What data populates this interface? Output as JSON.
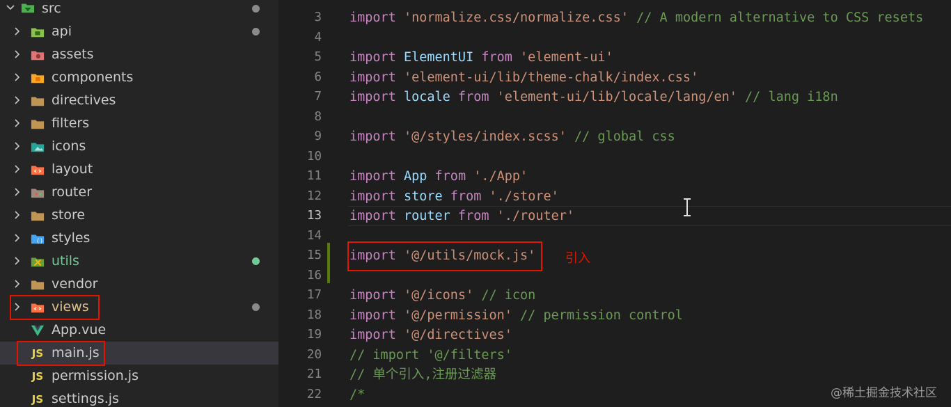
{
  "explorer": {
    "root": {
      "label": "src"
    },
    "items": [
      {
        "label": "api",
        "icon": "api-folder-icon",
        "dot": "#8a8a8a"
      },
      {
        "label": "assets",
        "icon": "assets-folder-icon"
      },
      {
        "label": "components",
        "icon": "components-folder-icon"
      },
      {
        "label": "directives",
        "icon": "folder-icon"
      },
      {
        "label": "filters",
        "icon": "folder-icon"
      },
      {
        "label": "icons",
        "icon": "images-folder-icon"
      },
      {
        "label": "layout",
        "icon": "layout-folder-icon"
      },
      {
        "label": "router",
        "icon": "router-folder-icon"
      },
      {
        "label": "store",
        "icon": "folder-icon"
      },
      {
        "label": "styles",
        "icon": "styles-folder-icon"
      },
      {
        "label": "utils",
        "icon": "utils-folder-icon",
        "dot": "#73c991"
      },
      {
        "label": "vendor",
        "icon": "folder-icon"
      },
      {
        "label": "views",
        "icon": "views-folder-icon",
        "dot": "#8a8a8a"
      },
      {
        "label": "App.vue",
        "icon": "vue-icon"
      },
      {
        "label": "main.js",
        "icon": "js-icon"
      },
      {
        "label": "permission.js",
        "icon": "js-icon"
      },
      {
        "label": "settings.js",
        "icon": "js-icon"
      }
    ],
    "js_badge": "JS"
  },
  "editor": {
    "lines": [
      {
        "n": "3",
        "tokens": [
          [
            "kw",
            "import "
          ],
          [
            "str",
            "'normalize.css/normalize.css'"
          ],
          [
            "pl",
            " "
          ],
          [
            "cmt",
            "// A modern alternative to CSS resets"
          ]
        ]
      },
      {
        "n": "4",
        "tokens": []
      },
      {
        "n": "5",
        "tokens": [
          [
            "kw",
            "import "
          ],
          [
            "id",
            "ElementUI"
          ],
          [
            "kw",
            " from "
          ],
          [
            "str",
            "'element-ui'"
          ]
        ]
      },
      {
        "n": "6",
        "tokens": [
          [
            "kw",
            "import "
          ],
          [
            "str",
            "'element-ui/lib/theme-chalk/index.css'"
          ]
        ]
      },
      {
        "n": "7",
        "tokens": [
          [
            "kw",
            "import "
          ],
          [
            "id",
            "locale"
          ],
          [
            "kw",
            " from "
          ],
          [
            "str",
            "'element-ui/lib/locale/lang/en'"
          ],
          [
            "pl",
            " "
          ],
          [
            "cmt",
            "// lang i18n"
          ]
        ]
      },
      {
        "n": "8",
        "tokens": []
      },
      {
        "n": "9",
        "tokens": [
          [
            "kw",
            "import "
          ],
          [
            "str",
            "'@/styles/index.scss'"
          ],
          [
            "pl",
            " "
          ],
          [
            "cmt",
            "// global css"
          ]
        ]
      },
      {
        "n": "10",
        "tokens": []
      },
      {
        "n": "11",
        "tokens": [
          [
            "kw",
            "import "
          ],
          [
            "id",
            "App"
          ],
          [
            "kw",
            " from "
          ],
          [
            "str",
            "'./App'"
          ]
        ]
      },
      {
        "n": "12",
        "tokens": [
          [
            "kw",
            "import "
          ],
          [
            "id",
            "store"
          ],
          [
            "kw",
            " from "
          ],
          [
            "str",
            "'./store'"
          ]
        ]
      },
      {
        "n": "13",
        "tokens": [
          [
            "kw",
            "import "
          ],
          [
            "id",
            "router"
          ],
          [
            "kw",
            " from "
          ],
          [
            "str",
            "'./router'"
          ]
        ]
      },
      {
        "n": "14",
        "tokens": []
      },
      {
        "n": "15",
        "tokens": [
          [
            "kw",
            "import "
          ],
          [
            "str",
            "'@/utils/mock.js'"
          ]
        ]
      },
      {
        "n": "16",
        "tokens": []
      },
      {
        "n": "17",
        "tokens": [
          [
            "kw",
            "import "
          ],
          [
            "str",
            "'@/icons'"
          ],
          [
            "pl",
            " "
          ],
          [
            "cmt",
            "// icon"
          ]
        ]
      },
      {
        "n": "18",
        "tokens": [
          [
            "kw",
            "import "
          ],
          [
            "str",
            "'@/permission'"
          ],
          [
            "pl",
            " "
          ],
          [
            "cmt",
            "// permission control"
          ]
        ]
      },
      {
        "n": "19",
        "tokens": [
          [
            "kw",
            "import "
          ],
          [
            "str",
            "'@/directives'"
          ]
        ]
      },
      {
        "n": "20",
        "tokens": [
          [
            "cmt",
            "// import '@/filters'"
          ]
        ]
      },
      {
        "n": "21",
        "tokens": [
          [
            "cmt",
            "// 单个引入,注册过滤器"
          ]
        ]
      },
      {
        "n": "22",
        "tokens": [
          [
            "cmt",
            "/*"
          ]
        ]
      }
    ],
    "active_line": "13",
    "annotation": "引入"
  },
  "watermark": "@稀土掘金技术社区",
  "colors": {
    "highlight_red": "#e51400"
  }
}
